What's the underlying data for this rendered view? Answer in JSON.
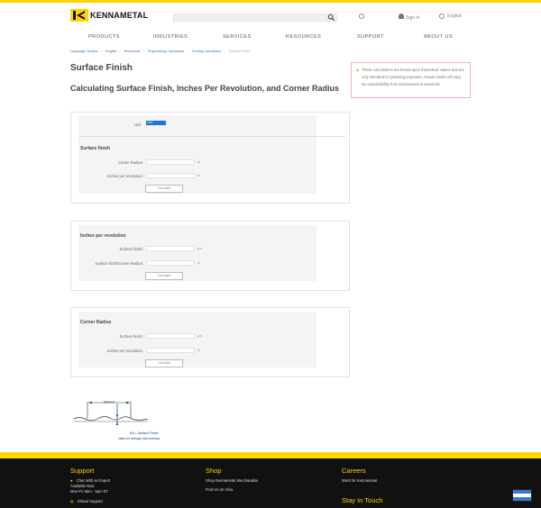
{
  "header": {
    "logo_text": "KENNAMETAL",
    "sign_in": "Sign In",
    "language": "English"
  },
  "nav": [
    "PRODUCTS",
    "INDUSTRIES",
    "SERVICES",
    "RESOURCES",
    "SUPPORT",
    "ABOUT US"
  ],
  "breadcrumb": [
    "Language Toolbox",
    "English",
    "Resources",
    "Engineering Calculators",
    "Turning Calculators",
    "Surface Finish"
  ],
  "page": {
    "title": "Surface Finish",
    "subtitle": "Calculating Surface Finish, Inches Per Revolution, and Corner Radius",
    "note": "These calculations are based upon theoretical values and are only intended for planning purposes. Actual results will vary. No responsibility from Kennametal is assumed."
  },
  "panels": {
    "p1": {
      "units_label": "Unit",
      "units_value": "inch",
      "title": "Surface finish",
      "row1": "Corner Radius:",
      "row2": "Inches per revolution:",
      "unit1": "in",
      "unit2": "in",
      "button": "Calculate"
    },
    "p2": {
      "title": "Inches per revolution",
      "row1": "Surface finish:",
      "row2": "Surface finishCorner Radius:",
      "unit1": "µin",
      "unit2": "in",
      "button": "Calculate"
    },
    "p3": {
      "title": "Corner Radius",
      "row1": "Surface finish:",
      "row2": "Inches per revolution:",
      "unit1": "µin",
      "unit2": "in",
      "button": "Calculate"
    }
  },
  "diagram": {
    "label_top": "Mmmm",
    "label_bottom_1": "Ra = Surface Finish",
    "label_bottom_2": "value (in average microinches)"
  },
  "footer": {
    "support_title": "Support",
    "support_items": [
      "Chat With an Expert",
      "Available Now",
      "Mon-Fri 8am - 5pm ET",
      "Global Support"
    ],
    "shop_title": "Shop",
    "shop_items": [
      "Shop Kennametal Merchandise",
      "Find Us on Arba"
    ],
    "careers_title": "Careers",
    "careers_items": [
      "Work for Kennametal"
    ],
    "stay_title": "Stay In Touch"
  }
}
